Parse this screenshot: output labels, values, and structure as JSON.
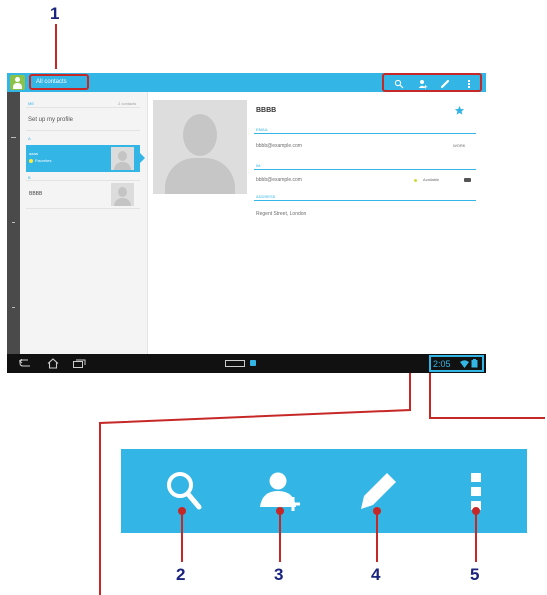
{
  "callouts": [
    "1",
    "2",
    "3",
    "4",
    "5"
  ],
  "colors": {
    "accent": "#33b5e5",
    "callout_line": "#c62828",
    "label": "#1a237e",
    "nav_bar": "#111111"
  },
  "action_bar": {
    "title": "All contacts",
    "icons": [
      "search-icon",
      "add-contact-icon",
      "edit-icon",
      "overflow-menu-icon"
    ]
  },
  "contact_list": {
    "header_left": "ME",
    "header_right": "2 contacts",
    "set_up_profile": "Set up my profile",
    "section_a": "A",
    "selected_name": "aaaa",
    "selected_sub": "Favorites",
    "section_b": "B",
    "other_name": "BBBB"
  },
  "detail": {
    "name": "BBBB",
    "email_header": "EMAIL",
    "email_value": "bbbb@example.com",
    "email_type": "WORK",
    "im_header": "IM",
    "im_value": "bbbb@example.com",
    "im_status": "Available",
    "address_header": "ADDRESS",
    "address_value": "Regent Street, London"
  },
  "nav_bar": {
    "time": "2:05"
  },
  "zoom_bar": {
    "icons": [
      "search-icon",
      "add-contact-icon",
      "edit-icon",
      "overflow-menu-icon"
    ]
  }
}
